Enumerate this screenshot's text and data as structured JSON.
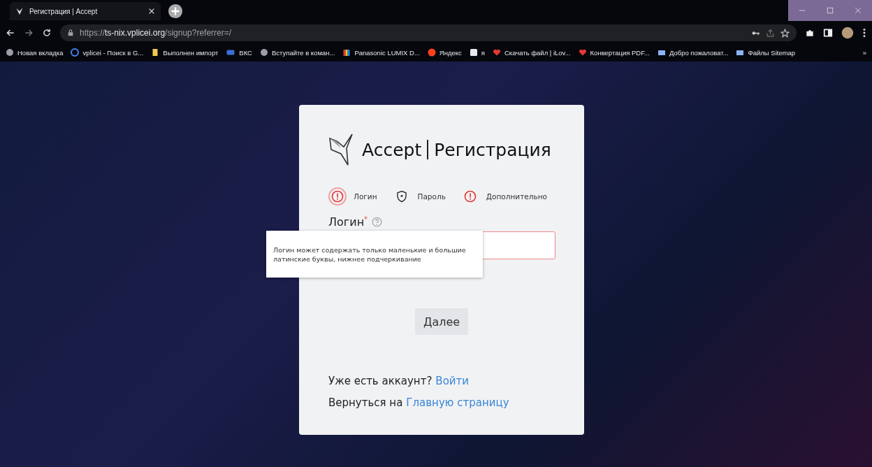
{
  "browser": {
    "tab": {
      "title": "Регистрация | Accept",
      "selected": true
    },
    "address": {
      "scheme": "https://",
      "host": "ts-nix.vplicei.org",
      "path": "/signup?referrer=/"
    },
    "bookmarks": [
      {
        "label": "Новая вкладка",
        "kind": "globe"
      },
      {
        "label": "vplicei - Поиск в G...",
        "kind": "google"
      },
      {
        "label": "Выполнен импорт",
        "kind": "folder"
      },
      {
        "label": "ВКС",
        "kind": "tile"
      },
      {
        "label": "Вступайте в коман...",
        "kind": "globe"
      },
      {
        "label": "Panasonic LUMIX D...",
        "kind": "bars"
      },
      {
        "label": "Яндекс",
        "kind": "yandex"
      },
      {
        "label": "я",
        "kind": "blank"
      },
      {
        "label": "Скачать файл | iLov...",
        "kind": "heart"
      },
      {
        "label": "Конвертация PDF...",
        "kind": "heart"
      },
      {
        "label": "Добро пожаловат...",
        "kind": "site"
      },
      {
        "label": "Файлы Sitemap",
        "kind": "site"
      }
    ],
    "more_bookmarks": "»"
  },
  "card": {
    "brand": "Accept",
    "title": "Регистрация",
    "steps": [
      {
        "label": "Логин",
        "kind": "error",
        "selected": true
      },
      {
        "label": "Пароль",
        "kind": "shield",
        "selected": false
      },
      {
        "label": "Дополнительно",
        "kind": "error",
        "selected": false
      }
    ],
    "field": {
      "label": "Логин",
      "required": "*",
      "error": true
    },
    "tooltip": "Логин может содержать только маленькие и большие латинские буквы, нижнее подчеркивание",
    "next_button": "Далее",
    "footer": [
      {
        "text": "Уже есть аккаунт?",
        "link": "Войти"
      },
      {
        "text": "Вернуться на",
        "link": "Главную страницу"
      }
    ]
  }
}
